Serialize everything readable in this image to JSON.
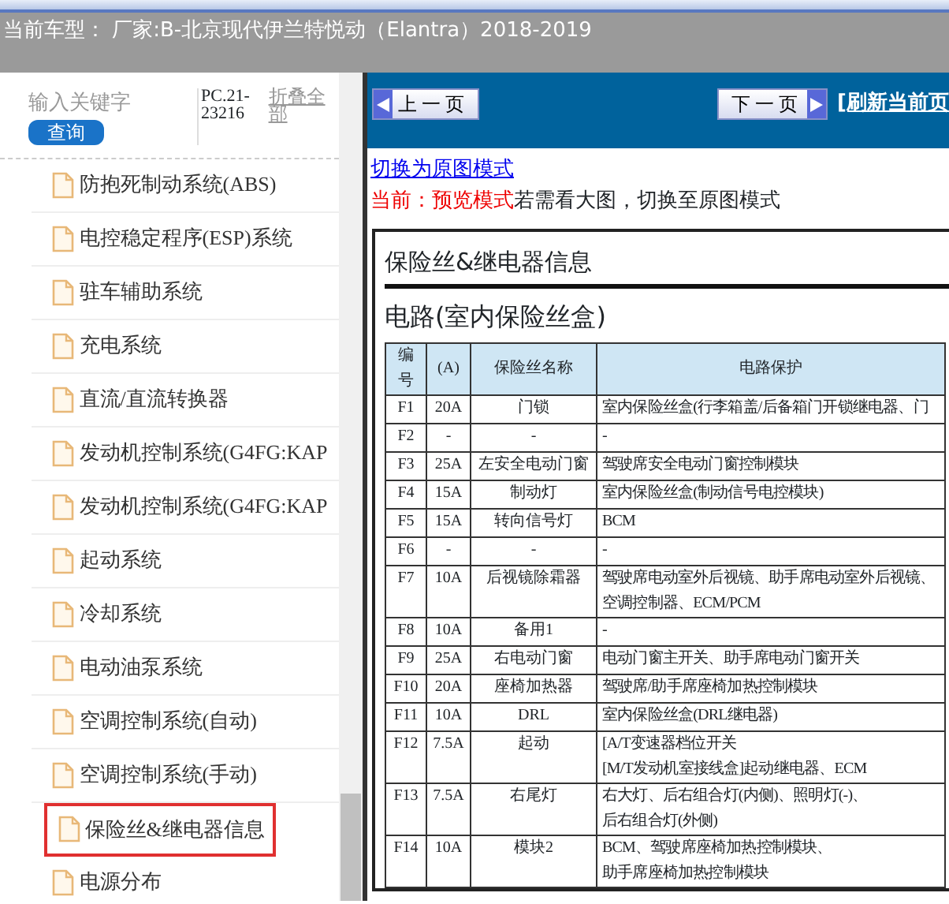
{
  "header": {
    "title": "当前车型：  厂家:B-北京现代伊兰特悦动（Elantra）2018-2019"
  },
  "sidebar": {
    "search": {
      "placeholder": "输入关键字"
    },
    "search_button": "查询",
    "code": "PC.21-23216",
    "collapse_all": "折叠全部",
    "items": [
      {
        "label": "防抱死制动系统(ABS)",
        "selected": false
      },
      {
        "label": "电控稳定程序(ESP)系统",
        "selected": false
      },
      {
        "label": "驻车辅助系统",
        "selected": false
      },
      {
        "label": "充电系统",
        "selected": false
      },
      {
        "label": "直流/直流转换器",
        "selected": false
      },
      {
        "label": "发动机控制系统(G4FG:KAP",
        "selected": false
      },
      {
        "label": "发动机控制系统(G4FG:KAP",
        "selected": false
      },
      {
        "label": "起动系统",
        "selected": false
      },
      {
        "label": "冷却系统",
        "selected": false
      },
      {
        "label": "电动油泵系统",
        "selected": false
      },
      {
        "label": "空调控制系统(自动)",
        "selected": false
      },
      {
        "label": "空调控制系统(手动)",
        "selected": false
      },
      {
        "label": "保险丝&继电器信息",
        "selected": true
      },
      {
        "label": "电源分布",
        "selected": false
      }
    ]
  },
  "toolbar": {
    "prev": "上一页",
    "next": "下一页",
    "refresh": "[刷新当前页"
  },
  "mode_link": "切换为原图模式",
  "mode_note": {
    "current": "当前：预览模式",
    "hint": "若需看大图，切换至原图模式"
  },
  "document": {
    "title": "保险丝&继电器信息",
    "subtitle": "电路(室内保险丝盒)",
    "table": {
      "columns": [
        "编号",
        "(A)",
        "保险丝名称",
        "电路保护"
      ],
      "rows": [
        {
          "no": "F1",
          "amp": "20A",
          "name": "门锁",
          "protect": [
            "室内保险丝盒(行李箱盖/后备箱门开锁继电器、门"
          ]
        },
        {
          "no": "F2",
          "amp": "-",
          "name": "-",
          "protect": [
            "-"
          ]
        },
        {
          "no": "F3",
          "amp": "25A",
          "name": "左安全电动门窗",
          "protect": [
            "驾驶席安全电动门窗控制模块"
          ]
        },
        {
          "no": "F4",
          "amp": "15A",
          "name": "制动灯",
          "protect": [
            "室内保险丝盒(制动信号电控模块)"
          ]
        },
        {
          "no": "F5",
          "amp": "15A",
          "name": "转向信号灯",
          "protect": [
            "BCM"
          ]
        },
        {
          "no": "F6",
          "amp": "-",
          "name": "-",
          "protect": [
            "-"
          ]
        },
        {
          "no": "F7",
          "amp": "10A",
          "name": "后视镜除霜器",
          "protect": [
            "驾驶席电动室外后视镜、助手席电动室外后视镜、",
            "空调控制器、ECM/PCM"
          ]
        },
        {
          "no": "F8",
          "amp": "10A",
          "name": "备用1",
          "protect": [
            "-"
          ]
        },
        {
          "no": "F9",
          "amp": "25A",
          "name": "右电动门窗",
          "protect": [
            "电动门窗主开关、助手席电动门窗开关"
          ]
        },
        {
          "no": "F10",
          "amp": "20A",
          "name": "座椅加热器",
          "protect": [
            "驾驶席/助手席座椅加热控制模块"
          ]
        },
        {
          "no": "F11",
          "amp": "10A",
          "name": "DRL",
          "protect": [
            "室内保险丝盒(DRL继电器)"
          ]
        },
        {
          "no": "F12",
          "amp": "7.5A",
          "name": "起动",
          "protect": [
            "[A/T变速器档位开关",
            "[M/T发动机室接线盒]起动继电器、ECM"
          ]
        },
        {
          "no": "F13",
          "amp": "7.5A",
          "name": "右尾灯",
          "protect": [
            "右大灯、后右组合灯(内侧)、照明灯(-)、",
            "后右组合灯(外侧)"
          ]
        },
        {
          "no": "F14",
          "amp": "10A",
          "name": "模块2",
          "protect": [
            "BCM、驾驶席座椅加热控制模块、",
            "助手席座椅加热控制模块"
          ]
        }
      ]
    }
  }
}
